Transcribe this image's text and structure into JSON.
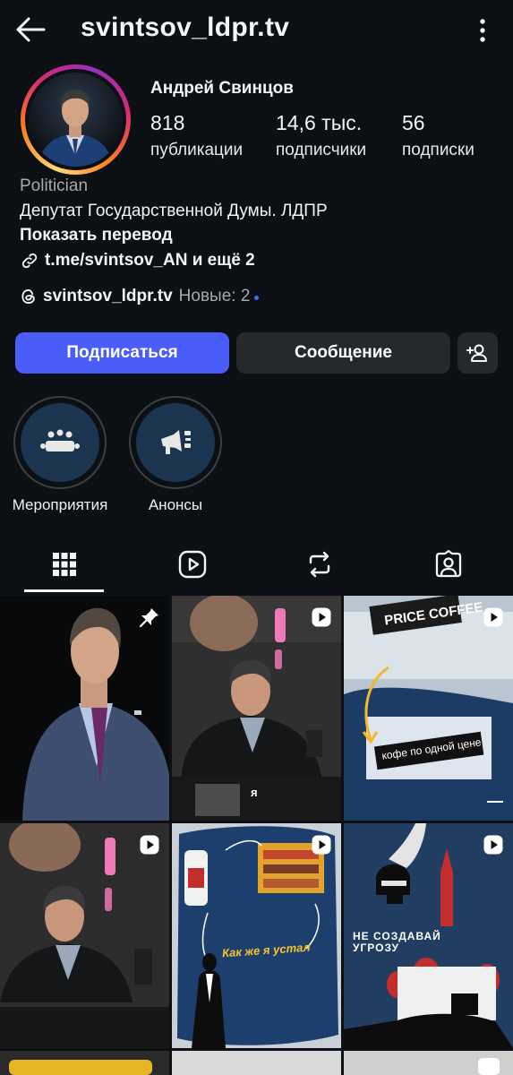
{
  "header": {
    "username": "svintsov_ldpr.tv",
    "back_icon": "arrow-left-icon",
    "menu_icon": "more-vertical-icon"
  },
  "profile": {
    "full_name": "Андрей Свинцов",
    "stats": [
      {
        "value": "818",
        "label": "публикации"
      },
      {
        "value": "14,6 тыс.",
        "label": "подписчики"
      },
      {
        "value": "56",
        "label": "подписки"
      }
    ],
    "category": "Politician",
    "bio": "Депутат Государственной Думы. ЛДПР",
    "show_translation": "Показать перевод",
    "link_text": "t.me/svintsov_AN и ещё 2",
    "threads_handle": "svintsov_ldpr.tv",
    "threads_new": "Новые: 2"
  },
  "actions": {
    "follow_label": "Подписаться",
    "message_label": "Сообщение",
    "add_user_icon": "add-person-icon"
  },
  "highlights": [
    {
      "label": "Мероприятия",
      "icon": "meeting-table-icon"
    },
    {
      "label": "Анонсы",
      "icon": "megaphone-icon"
    }
  ],
  "tabs": [
    {
      "name": "posts",
      "icon": "grid-icon",
      "active": true
    },
    {
      "name": "reels",
      "icon": "reels-icon",
      "active": false
    },
    {
      "name": "reposts",
      "icon": "repost-icon",
      "active": false
    },
    {
      "name": "tagged",
      "icon": "tagged-person-icon",
      "active": false
    }
  ],
  "posts": [
    {
      "type": "photo",
      "pinned": true,
      "caption": ""
    },
    {
      "type": "reel",
      "pinned": false,
      "caption": "я"
    },
    {
      "type": "reel",
      "pinned": false,
      "caption": "PRICE COFFEE",
      "sign": "кофе по одной цене"
    },
    {
      "type": "reel",
      "pinned": false,
      "caption": ""
    },
    {
      "type": "reel",
      "pinned": false,
      "caption": "Как же я устал"
    },
    {
      "type": "reel",
      "pinned": false,
      "caption": "НЕ СОЗДАВАЙ УГРОЗУ"
    }
  ],
  "colors": {
    "background": "#0c1014",
    "follow_button": "#4a5df9",
    "secondary_button": "#25292e",
    "muted_text": "#a8a8a8",
    "new_dot": "#3d6cff"
  }
}
